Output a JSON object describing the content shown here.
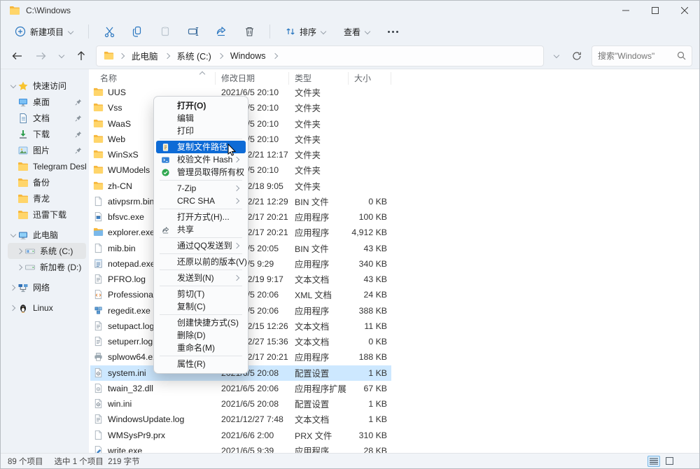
{
  "window": {
    "title": "C:\\Windows"
  },
  "toolbar": {
    "new_item_label": "新建项目",
    "sort_label": "排序",
    "view_label": "查看"
  },
  "navbar": {
    "breadcrumb": [
      "此电脑",
      "系统 (C:)",
      "Windows"
    ],
    "search_placeholder": "搜索\"Windows\""
  },
  "sidebar": {
    "items": [
      {
        "label": "快速访问",
        "icon": "star",
        "depth": 0,
        "expander": "down"
      },
      {
        "label": "桌面",
        "icon": "desktop",
        "depth": 1,
        "pinned": true
      },
      {
        "label": "文档",
        "icon": "document",
        "depth": 1,
        "pinned": true
      },
      {
        "label": "下载",
        "icon": "download",
        "depth": 1,
        "pinned": true
      },
      {
        "label": "图片",
        "icon": "pictures",
        "depth": 1,
        "pinned": true
      },
      {
        "label": "Telegram Desktop",
        "icon": "folder",
        "depth": 1
      },
      {
        "label": "备份",
        "icon": "folder",
        "depth": 1
      },
      {
        "label": "青龙",
        "icon": "folder",
        "depth": 1
      },
      {
        "label": "迅雷下载",
        "icon": "folder",
        "depth": 1
      },
      {
        "label": "此电脑",
        "icon": "computer",
        "depth": 0,
        "expander": "down",
        "gap": true
      },
      {
        "label": "系统 (C:)",
        "icon": "drive-c",
        "depth": 2,
        "expander": "right",
        "selected": true
      },
      {
        "label": "新加卷 (D:)",
        "icon": "drive-d",
        "depth": 2,
        "expander": "right"
      },
      {
        "label": "网络",
        "icon": "network",
        "depth": 0,
        "expander": "right",
        "gap": true
      },
      {
        "label": "Linux",
        "icon": "linux",
        "depth": 0,
        "expander": "right",
        "gap": true
      }
    ]
  },
  "filelist": {
    "columns": [
      "名称",
      "修改日期",
      "类型",
      "大小"
    ],
    "rows": [
      {
        "name": "UUS",
        "icon": "folder",
        "date": "2021/6/5 20:10",
        "type": "文件夹",
        "size": ""
      },
      {
        "name": "Vss",
        "icon": "folder",
        "date": "2021/6/5 20:10",
        "type": "文件夹",
        "size": ""
      },
      {
        "name": "WaaS",
        "icon": "folder",
        "date": "2021/6/5 20:10",
        "type": "文件夹",
        "size": ""
      },
      {
        "name": "Web",
        "icon": "folder",
        "date": "2021/6/5 20:10",
        "type": "文件夹",
        "size": ""
      },
      {
        "name": "WinSxS",
        "icon": "folder",
        "date": "2021/12/21 12:17",
        "type": "文件夹",
        "size": ""
      },
      {
        "name": "WUModels",
        "icon": "folder",
        "date": "2021/6/5 20:10",
        "type": "文件夹",
        "size": ""
      },
      {
        "name": "zh-CN",
        "icon": "folder",
        "date": "2021/12/18 9:05",
        "type": "文件夹",
        "size": ""
      },
      {
        "name": "ativpsrm.bin",
        "icon": "file",
        "date": "2021/12/21 12:29",
        "type": "BIN 文件",
        "size": "0 KB"
      },
      {
        "name": "bfsvc.exe",
        "icon": "exe",
        "date": "2021/12/17 20:21",
        "type": "应用程序",
        "size": "100 KB"
      },
      {
        "name": "explorer.exe",
        "icon": "explorer",
        "date": "2021/12/17 20:21",
        "type": "应用程序",
        "size": "4,912 KB"
      },
      {
        "name": "mib.bin",
        "icon": "file",
        "date": "2021/6/5 20:05",
        "type": "BIN 文件",
        "size": "43 KB"
      },
      {
        "name": "notepad.exe",
        "icon": "notepad",
        "date": "2021/6/5 9:29",
        "type": "应用程序",
        "size": "340 KB"
      },
      {
        "name": "PFRO.log",
        "icon": "text",
        "date": "2021/12/19 9:17",
        "type": "文本文档",
        "size": "43 KB"
      },
      {
        "name": "Professional.xml",
        "icon": "xml",
        "date": "2021/6/5 20:06",
        "type": "XML 文档",
        "size": "24 KB"
      },
      {
        "name": "regedit.exe",
        "icon": "regedit",
        "date": "2021/6/5 20:06",
        "type": "应用程序",
        "size": "388 KB"
      },
      {
        "name": "setupact.log",
        "icon": "text",
        "date": "2021/12/15 12:26",
        "type": "文本文档",
        "size": "11 KB"
      },
      {
        "name": "setuperr.log",
        "icon": "text",
        "date": "2021/12/27 15:36",
        "type": "文本文档",
        "size": "0 KB"
      },
      {
        "name": "splwow64.exe",
        "icon": "printer",
        "date": "2021/12/17 20:21",
        "type": "应用程序",
        "size": "188 KB"
      },
      {
        "name": "system.ini",
        "icon": "ini",
        "date": "2021/6/5 20:08",
        "type": "配置设置",
        "size": "1 KB",
        "selected": true
      },
      {
        "name": "twain_32.dll",
        "icon": "dll",
        "date": "2021/6/5 20:06",
        "type": "应用程序扩展",
        "size": "67 KB"
      },
      {
        "name": "win.ini",
        "icon": "ini",
        "date": "2021/6/5 20:08",
        "type": "配置设置",
        "size": "1 KB"
      },
      {
        "name": "WindowsUpdate.log",
        "icon": "text",
        "date": "2021/12/27 7:48",
        "type": "文本文档",
        "size": "1 KB"
      },
      {
        "name": "WMSysPr9.prx",
        "icon": "file",
        "date": "2021/6/6 2:00",
        "type": "PRX 文件",
        "size": "310 KB"
      },
      {
        "name": "write.exe",
        "icon": "write",
        "date": "2021/6/5 9:39",
        "type": "应用程序",
        "size": "28 KB"
      }
    ]
  },
  "context_menu": {
    "items": [
      {
        "label": "打开(O)",
        "bold": true
      },
      {
        "label": "编辑"
      },
      {
        "label": "打印"
      },
      {
        "type": "separator"
      },
      {
        "label": "复制文件路径",
        "icon": "copy-path",
        "highlighted": true
      },
      {
        "label": "校验文件 Hash",
        "icon": "hash",
        "submenu": true
      },
      {
        "label": "管理员取得所有权",
        "icon": "admin"
      },
      {
        "type": "separator"
      },
      {
        "label": "7-Zip",
        "submenu": true
      },
      {
        "label": "CRC SHA",
        "submenu": true
      },
      {
        "type": "separator"
      },
      {
        "label": "打开方式(H)..."
      },
      {
        "label": "共享",
        "icon": "share"
      },
      {
        "type": "separator"
      },
      {
        "label": "通过QQ发送到",
        "submenu": true
      },
      {
        "type": "separator"
      },
      {
        "label": "还原以前的版本(V)"
      },
      {
        "type": "separator"
      },
      {
        "label": "发送到(N)",
        "submenu": true
      },
      {
        "type": "separator"
      },
      {
        "label": "剪切(T)"
      },
      {
        "label": "复制(C)"
      },
      {
        "type": "separator"
      },
      {
        "label": "创建快捷方式(S)"
      },
      {
        "label": "删除(D)"
      },
      {
        "label": "重命名(M)"
      },
      {
        "type": "separator"
      },
      {
        "label": "属性(R)"
      }
    ]
  },
  "statusbar": {
    "items_count": "89 个项目",
    "selection": "选中 1 个项目",
    "selection_bytes": "219 字节"
  },
  "colors": {
    "accent": "#0e6bd6",
    "selected_row": "#cde8ff"
  }
}
